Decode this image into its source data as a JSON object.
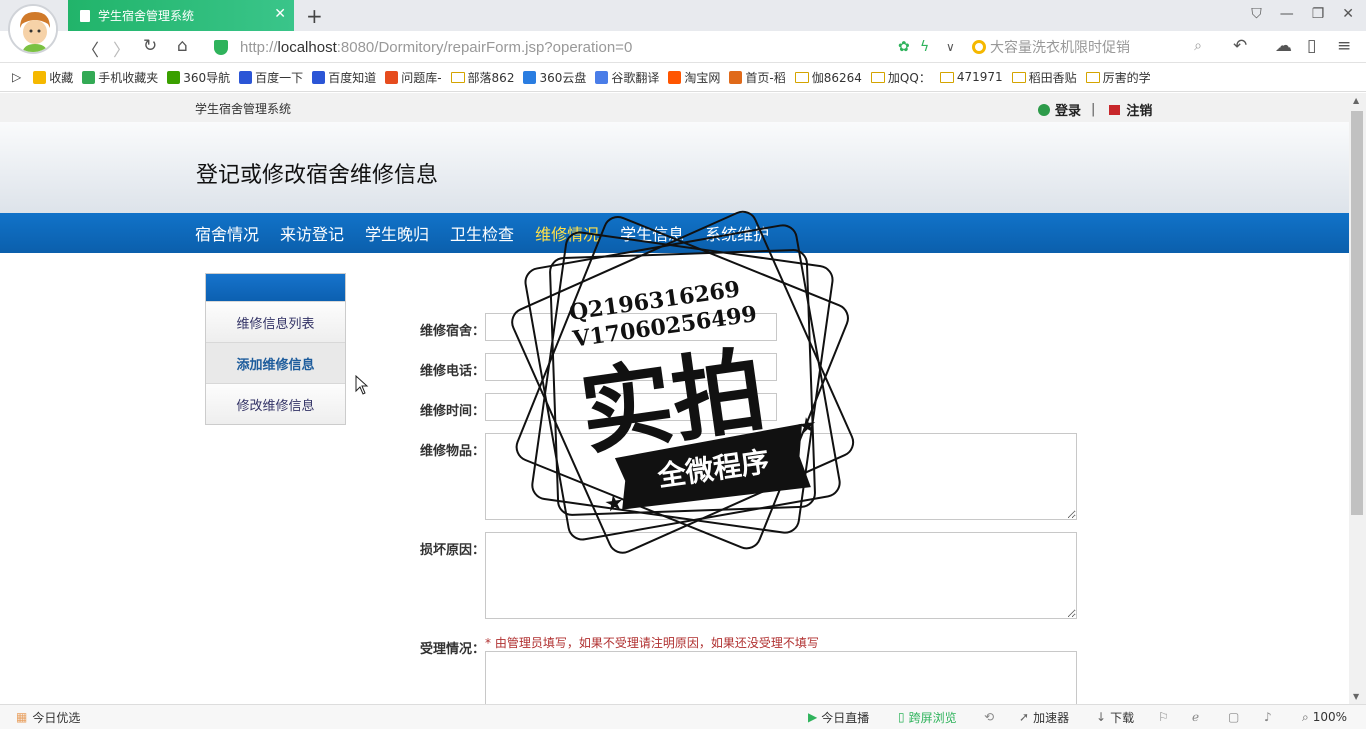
{
  "browser": {
    "tab_title": "学生宿舍管理系统",
    "url_prefix": "http://",
    "url_host": "localhost",
    "url_rest": ":8080/Dormitory/repairForm.jsp?operation=0",
    "search_placeholder": "大容量洗衣机限时促销",
    "bookmarks": [
      {
        "label": "收藏",
        "color": "#f5b800"
      },
      {
        "label": "手机收藏夹",
        "color": "#33aa55"
      },
      {
        "label": "360导航",
        "color": "#3aa000"
      },
      {
        "label": "百度一下",
        "color": "#2b55d6"
      },
      {
        "label": "百度知道",
        "color": "#2b55d6"
      },
      {
        "label": "问题库-",
        "color": "#e64c1e"
      },
      {
        "label": "部落862",
        "folder": true
      },
      {
        "label": "360云盘",
        "color": "#2a7de1"
      },
      {
        "label": "谷歌翻译",
        "color": "#4a7de8"
      },
      {
        "label": "淘宝网",
        "color": "#ff5500"
      },
      {
        "label": "首页-稻",
        "color": "#e06a1a"
      },
      {
        "label": "伽86264",
        "folder": true
      },
      {
        "label": "加QQ：",
        "folder": true
      },
      {
        "label": "471971",
        "folder": true
      },
      {
        "label": "稻田香贴",
        "folder": true
      },
      {
        "label": "厉害的学",
        "folder": true
      }
    ]
  },
  "site": {
    "system_name": "学生宿舍管理系统",
    "login": "登录",
    "separator": "|",
    "logout": "注销",
    "page_title": "登记或修改宿舍维修信息",
    "nav": [
      "宿舍情况",
      "来访登记",
      "学生晚归",
      "卫生检查",
      "维修情况",
      "学生信息",
      "系统维护"
    ],
    "sidebar": [
      "维修信息列表",
      "添加维修信息",
      "修改维修信息"
    ],
    "form": {
      "dorm_label": "维修宿舍：",
      "phone_label": "维修电话：",
      "time_label": "维修时间：",
      "item_label": "维修物品：",
      "reason_label": "损坏原因：",
      "status_label": "受理情况：",
      "status_hint": "* 由管理员填写，如果不受理请注明原因，如果还没受理不填写"
    },
    "stamp": {
      "line1": "Q2196316269",
      "line2": "V17060256499",
      "big": "实拍",
      "ribbon": "全微程序"
    }
  },
  "statusbar": {
    "left": "今日优选",
    "live": "今日直播",
    "cross": "跨屏浏览",
    "accel": "加速器",
    "download": "下载",
    "zoom": "100%"
  },
  "colors": {
    "nav_blue": "#0b5fac",
    "nav_active": "#ffe04a",
    "tab_green": "#21b46a",
    "hint_red": "#b03030"
  }
}
